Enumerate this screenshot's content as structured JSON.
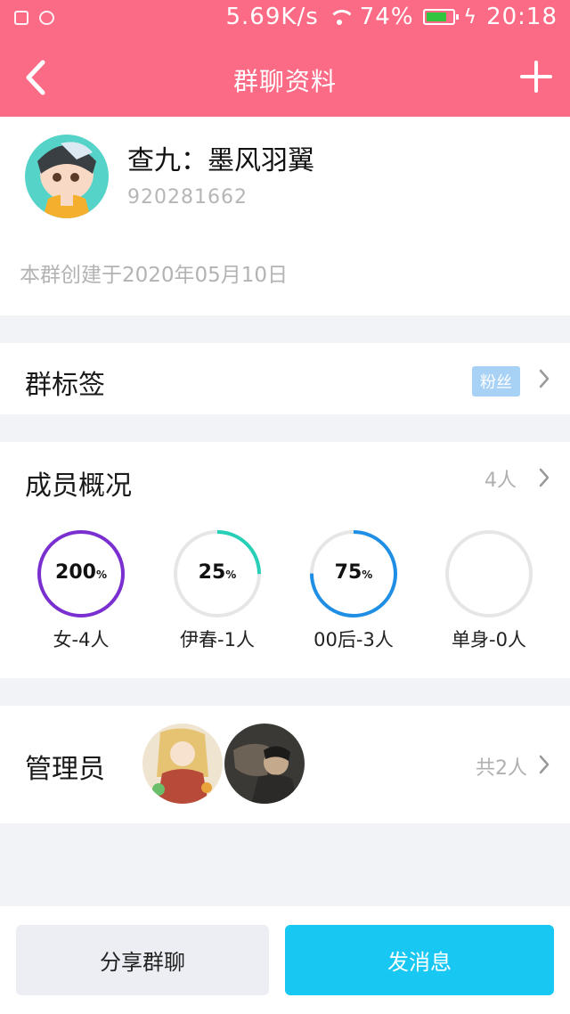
{
  "status_bar": {
    "network_speed": "5.69K/s",
    "battery_percent": "74%",
    "time": "20:18"
  },
  "title_bar": {
    "title": "群聊资料"
  },
  "group": {
    "name": "查九：墨风羽翼",
    "id": "920281662",
    "created": "本群创建于2020年05月10日"
  },
  "tags": {
    "label": "群标签",
    "badge": "粉丝"
  },
  "members": {
    "label": "成员概况",
    "count": "4人",
    "stats": [
      {
        "value": "200",
        "unit": "%",
        "label": "女-4人",
        "fraction": 1.0,
        "color": "#7a2fd0"
      },
      {
        "value": "25",
        "unit": "%",
        "label": "伊春-1人",
        "fraction": 0.25,
        "color": "#26cfb6"
      },
      {
        "value": "75",
        "unit": "%",
        "label": "00后-3人",
        "fraction": 0.75,
        "color": "#1f8fe6"
      },
      {
        "value": "",
        "unit": "",
        "label": "单身-0人",
        "fraction": 0,
        "color": "#2a8fe6"
      }
    ]
  },
  "admins": {
    "label": "管理员",
    "count": "共2人"
  },
  "actions": {
    "share": "分享群聊",
    "send": "发消息"
  },
  "colors": {
    "header": "#fb6b86",
    "send_button": "#18c8f2",
    "tag_badge": "#a7d1f5"
  }
}
